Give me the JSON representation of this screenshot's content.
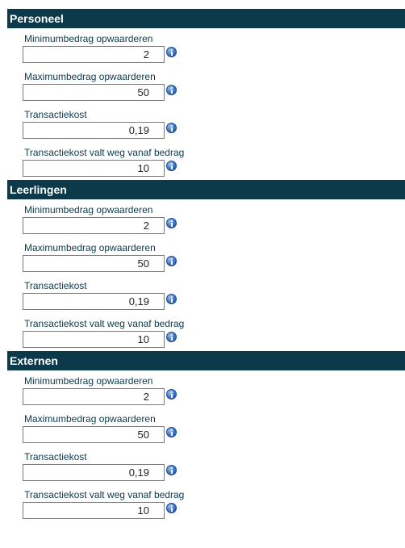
{
  "sections": [
    {
      "title": "Personeel",
      "fields": [
        {
          "label": "Minimumbedrag opwaarderen",
          "value": "2"
        },
        {
          "label": "Maximumbedrag opwaarderen",
          "value": "50"
        },
        {
          "label": "Transactiekost",
          "value": "0,19"
        },
        {
          "label": "Transactiekost valt weg vanaf bedrag",
          "value": "10"
        }
      ]
    },
    {
      "title": "Leerlingen",
      "fields": [
        {
          "label": "Minimumbedrag opwaarderen",
          "value": "2"
        },
        {
          "label": "Maximumbedrag opwaarderen",
          "value": "50"
        },
        {
          "label": "Transactiekost",
          "value": "0,19"
        },
        {
          "label": "Transactiekost valt weg vanaf bedrag",
          "value": "10"
        }
      ]
    },
    {
      "title": "Externen",
      "fields": [
        {
          "label": "Minimumbedrag opwaarderen",
          "value": "2"
        },
        {
          "label": "Maximumbedrag opwaarderen",
          "value": "50"
        },
        {
          "label": "Transactiekost",
          "value": "0,19"
        },
        {
          "label": "Transactiekost valt weg vanaf bedrag",
          "value": "10"
        }
      ]
    }
  ],
  "icons": {
    "info": "info-icon"
  },
  "colors": {
    "header_bg": "#0c3a4b",
    "header_text": "#ffffff",
    "label_text": "#0c3a4b",
    "info_icon": "#3b73c4"
  }
}
